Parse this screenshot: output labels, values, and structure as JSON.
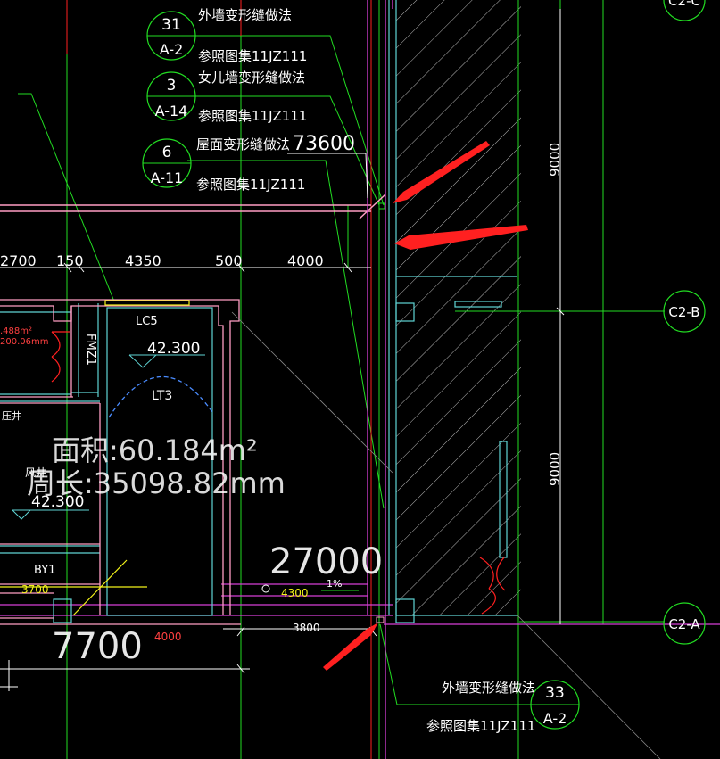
{
  "callouts": {
    "c31": {
      "num": "31",
      "ref": "A-2",
      "title": "外墙变形缝做法",
      "source": "参照图集11JZ111"
    },
    "c3": {
      "num": "3",
      "ref": "A-14",
      "title": "女儿墙变形缝做法",
      "source": "参照图集11JZ111"
    },
    "c6": {
      "num": "6",
      "ref": "A-11",
      "title": "屋面变形缝做法",
      "source": "参照图集11JZ111"
    },
    "c33": {
      "num": "33",
      "ref": "A-2",
      "title": "外墙变形缝做法",
      "source": "参照图集11JZ111"
    }
  },
  "elevation_top": "73600",
  "dimensions": {
    "d2700": "2700",
    "d150": "150",
    "d4350": "4350",
    "d500": "500",
    "d4000": "4000",
    "d3700": "3700",
    "d4000b": "4000",
    "d3800": "3800",
    "d4300": "4300",
    "big27000": "27000",
    "big7700": "7700",
    "v9000a": "9000",
    "v9000b": "9000"
  },
  "rooms": {
    "lc5": "LC5",
    "fmz1": "FMZ1",
    "lt3": "LT3",
    "by1": "BY1",
    "level1": "42.300",
    "level2": "42.300",
    "slope": "1%",
    "area_small": ".488m²",
    "perim_small": "200.06mm",
    "well": "压井",
    "fengjing": "风井"
  },
  "area_readout": {
    "area": "面积:60.184m²",
    "perimeter": "周长:35098.82mm"
  },
  "axes": {
    "c2c": "C2-C",
    "c2b": "C2-B",
    "c2a": "C2-A"
  },
  "colors": {
    "background": "#000000",
    "wall_pink": "#ff9ec4",
    "wall_magenta": "#d63fd6",
    "cyan": "#5fd4d4",
    "green": "#22dd22",
    "red": "#ff2020",
    "yellow": "#f2f21a",
    "white": "#ffffff"
  }
}
